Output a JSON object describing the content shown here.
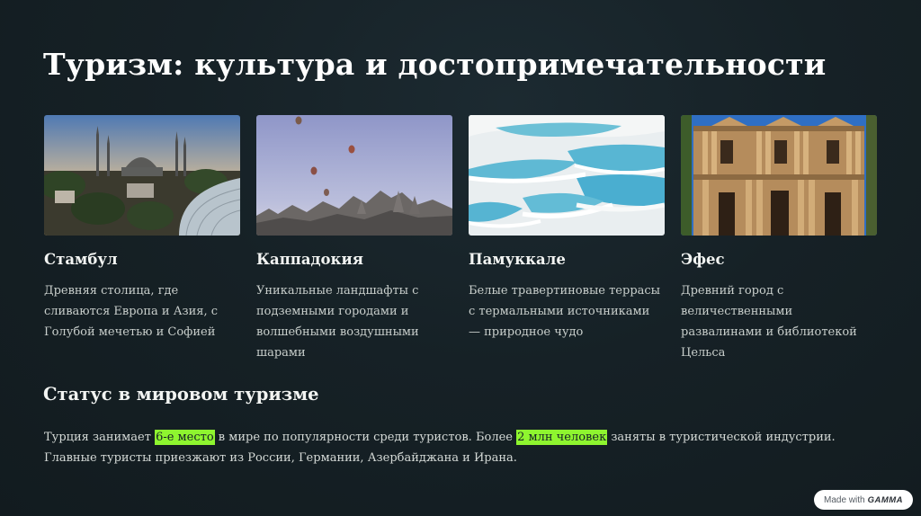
{
  "slide": {
    "title": "Туризм: культура и достопримечательности"
  },
  "cards": [
    {
      "title": "Стамбул",
      "desc": "Древняя столица, где сливаются Европа и Азия, с Голубой мечетью и Софией"
    },
    {
      "title": "Каппадокия",
      "desc": "Уникальные ландшафты с подземными городами и волшебными воздушными шарами"
    },
    {
      "title": "Памуккале",
      "desc": "Белые травертиновые террасы с термальными источниками — природное чудо"
    },
    {
      "title": "Эфес",
      "desc": "Древний город с величественными развалинами и библиотекой Цельса"
    }
  ],
  "status": {
    "heading": "Статус в мировом туризме",
    "text_1": "Турция занимает ",
    "highlight_1": "6-е место",
    "text_2": " в мире по популярности среди туристов. Более ",
    "highlight_2": "2 млн человек",
    "text_3": " заняты в туристической индустрии. Главные туристы приезжают из России, Германии, Азербайджана и Ирана."
  },
  "badge": {
    "made_with": "Made with",
    "brand": "GAMMA"
  },
  "colors": {
    "background": "#162126",
    "highlight": "#8ef52f"
  }
}
